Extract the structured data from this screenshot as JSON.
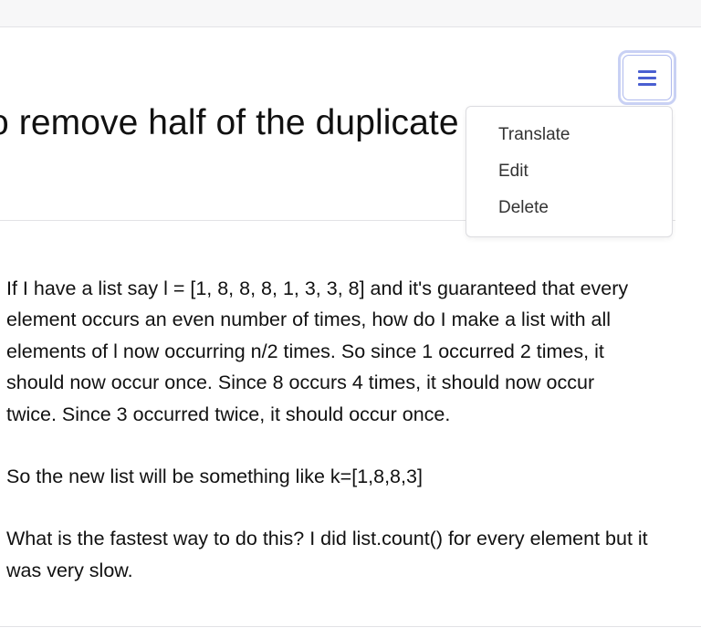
{
  "question": {
    "title": "o remove half of the duplicate",
    "paragraphs": [
      "If I have a list say l = [1, 8, 8, 8, 1, 3, 3, 8] and it's guaranteed that every element occurs an even number of times, how do I make a list with all elements of l now occurring n/2 times. So since 1 occurred 2 times, it should now occur once. Since 8 occurs 4 times, it should now occur twice. Since 3 occurred twice, it should occur once.",
      "So the new list will be something like k=[1,8,8,3]",
      "What is the fastest way to do this? I did list.count() for every element but it was very slow."
    ]
  },
  "menu": {
    "button_icon": "hamburger-icon",
    "items": [
      "Translate",
      "Edit",
      "Delete"
    ]
  },
  "colors": {
    "accent": "#4a5fd1",
    "button_border": "#c9d1f4",
    "divider": "#e2e2e5"
  }
}
